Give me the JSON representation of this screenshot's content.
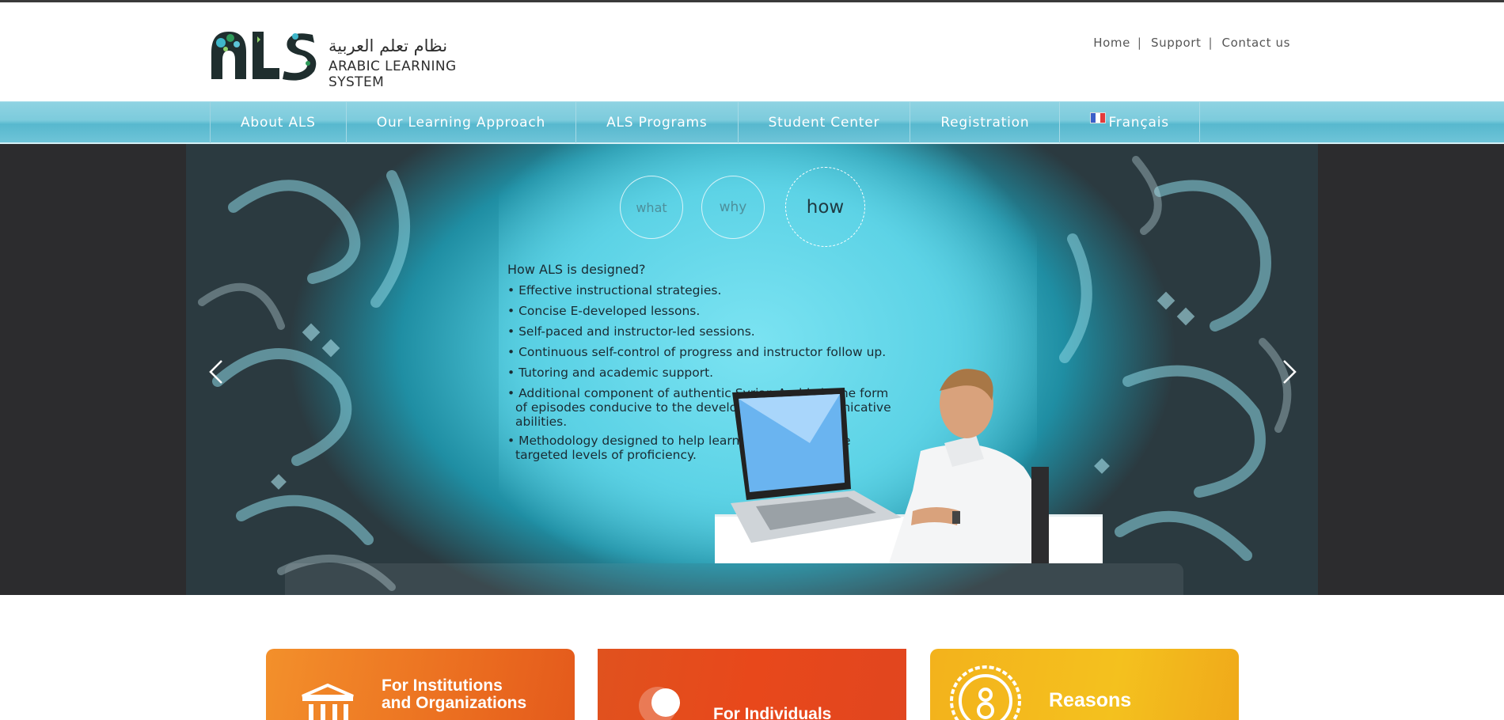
{
  "header": {
    "logo_arabic": "نظام تعلم العربية",
    "logo_english": "ARABIC LEARNING SYSTEM",
    "logo_mark": "ALS",
    "top_links": [
      {
        "label": "Home"
      },
      {
        "label": "Support"
      },
      {
        "label": "Contact us"
      }
    ],
    "separator": "|"
  },
  "nav": {
    "items": [
      {
        "label": "About ALS"
      },
      {
        "label": "Our Learning Approach"
      },
      {
        "label": "ALS Programs"
      },
      {
        "label": "Student Center"
      },
      {
        "label": "Registration"
      },
      {
        "label": "Français",
        "icon": "french-flag-icon"
      }
    ]
  },
  "slider": {
    "tabs": [
      {
        "label": "what"
      },
      {
        "label": "why"
      },
      {
        "label": "how"
      }
    ],
    "active_tab": "how",
    "heading": "How ALS is designed?",
    "bullets": [
      "• Effective instructional strategies.",
      "• Concise E-developed lessons.",
      "• Self-paced and instructor-led sessions.",
      "• Continuous self-control of progress and instructor follow up.",
      "• Tutoring and academic support.",
      "• Additional component of authentic Syrian Arabic in the form of episodes conducive to the development of communicative abilities.",
      "• Methodology designed to help learners to achieve the targeted levels of proficiency."
    ],
    "prev_icon": "chevron-left-icon",
    "next_icon": "chevron-right-icon"
  },
  "features": [
    {
      "title_line1": "For Institutions",
      "title_line2": "and Organizations",
      "icon": "institution-icon"
    },
    {
      "title_line1": "For Individuals",
      "title_line2": "",
      "icon": "chat-bubble-icon"
    },
    {
      "title_line1": "Reasons",
      "title_line2": "",
      "icon": "award-badge-icon"
    }
  ],
  "colors": {
    "nav_blue": "#6ec4d8",
    "orange": "#ea6a1f",
    "red_orange": "#e8481b",
    "yellow": "#f4c11e",
    "slider_bg": "#2c2c2e"
  }
}
